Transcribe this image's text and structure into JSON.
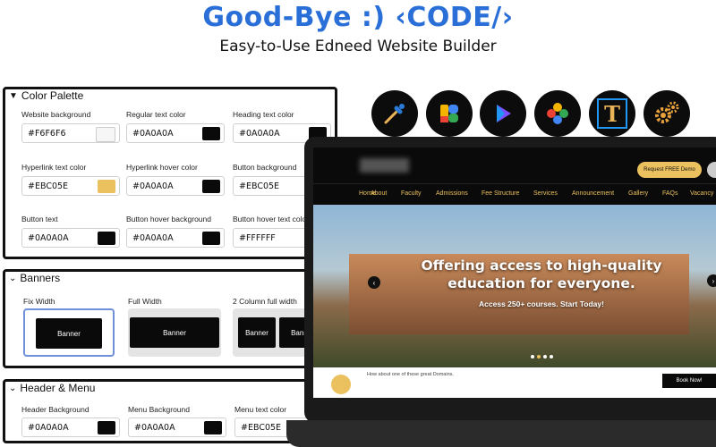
{
  "header": {
    "title": "Good-Bye :) ‹CODE/›",
    "subtitle": "Easy-to-Use Edneed Website Builder"
  },
  "color_palette": {
    "title": "Color Palette",
    "fields": [
      {
        "label": "Website background",
        "value": "#F6F6F6",
        "swatch": "#F6F6F6"
      },
      {
        "label": "Regular text color",
        "value": "#0A0A0A",
        "swatch": "#0A0A0A"
      },
      {
        "label": "Heading text color",
        "value": "#0A0A0A",
        "swatch": "#0A0A0A"
      },
      {
        "label": "Hyperlink text color",
        "value": "#EBC05E",
        "swatch": "#EBC05E"
      },
      {
        "label": "Hyperlink hover color",
        "value": "#0A0A0A",
        "swatch": "#0A0A0A"
      },
      {
        "label": "Button background",
        "value": "#EBC05E",
        "swatch": "#EBC05E"
      },
      {
        "label": "Button text",
        "value": "#0A0A0A",
        "swatch": "#0A0A0A"
      },
      {
        "label": "Button hover background",
        "value": "#0A0A0A",
        "swatch": "#0A0A0A"
      },
      {
        "label": "Button hover text color",
        "value": "#FFFFFF",
        "swatch": "#FFFFFF"
      }
    ]
  },
  "banners": {
    "title": "Banners",
    "options": [
      {
        "label": "Fix Width",
        "button": "Banner"
      },
      {
        "label": "Full Width",
        "button": "Banner"
      },
      {
        "label": "2 Column full width",
        "button": "Banner",
        "button2": "Banner"
      }
    ]
  },
  "header_menu": {
    "title": "Header & Menu",
    "fields": [
      {
        "label": "Header Background",
        "value": "#0A0A0A",
        "swatch": "#0A0A0A"
      },
      {
        "label": "Menu Background",
        "value": "#0A0A0A",
        "swatch": "#0A0A0A"
      },
      {
        "label": "Menu text color",
        "value": "#EBC05E",
        "swatch": "#EBC05E"
      }
    ]
  },
  "icons": [
    "color-picker-icon",
    "google-business-icon",
    "google-play-icon",
    "google-photos-icon",
    "typography-icon",
    "settings-gears-icon"
  ],
  "site_preview": {
    "cta": "Request FREE Demo",
    "menu": [
      "Home",
      "About",
      "Faculty",
      "Admissions",
      "Fee Structure",
      "Services",
      "Announcement",
      "Gallery",
      "FAQs",
      "Vacancy"
    ],
    "hero_heading_line1": "Offering access to high-quality",
    "hero_heading_line2": "education for everyone.",
    "hero_sub": "Access 250+ courses. Start Today!",
    "domain_text": "How about one of these great Domains.",
    "book_button": "Book Now!"
  },
  "colors": {
    "accent": "#2a6fd8",
    "gold": "#EBC05E",
    "dark": "#0A0A0A"
  }
}
